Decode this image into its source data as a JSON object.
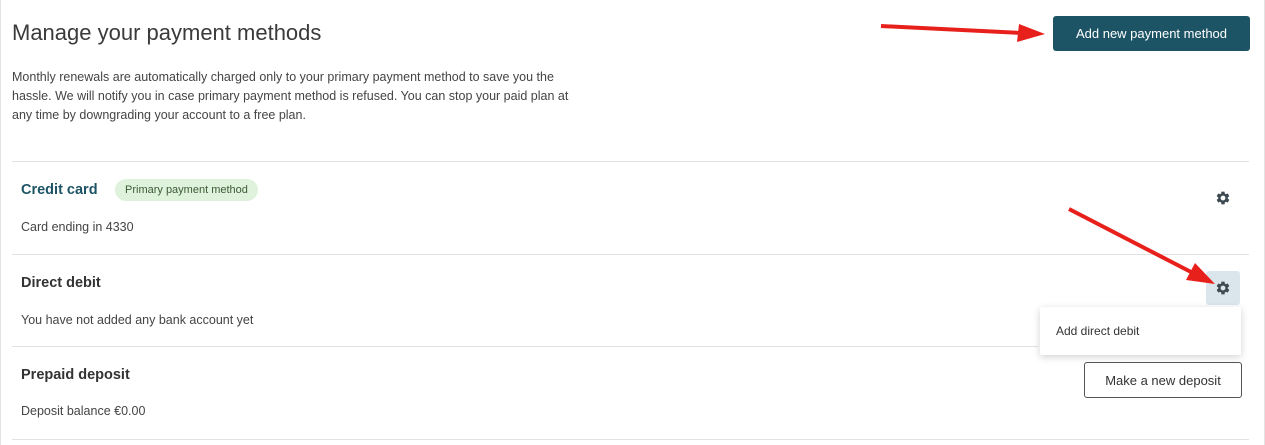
{
  "header": {
    "title": "Manage your payment methods",
    "intro": "Monthly renewals are automatically charged only to your primary payment method to save you the hassle. We will notify you in case primary payment method is refused. You can stop your paid plan at any time by downgrading your account to a free plan.",
    "add_button_label": "Add new payment method"
  },
  "methods": [
    {
      "title": "Credit card",
      "badge": "Primary payment method",
      "detail": "Card ending in 4330",
      "settings_icon": "gear-icon"
    },
    {
      "title": "Direct debit",
      "detail": "You have not added any bank account yet",
      "settings_icon": "gear-icon",
      "dropdown": {
        "items": [
          "Add direct debit"
        ]
      }
    },
    {
      "title": "Prepaid deposit",
      "detail": "Deposit balance €0.00",
      "action_label": "Make a new deposit"
    }
  ],
  "colors": {
    "accent": "#1d5465",
    "badge_bg": "#dff2dc",
    "annotation_arrow": "#e8201c"
  }
}
